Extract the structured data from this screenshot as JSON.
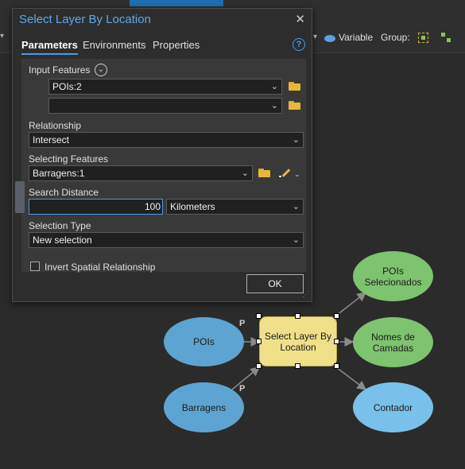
{
  "ribbon": {
    "variable_label": "Variable",
    "group_label": "Group:"
  },
  "dialog": {
    "title": "Select Layer By Location",
    "close_glyph": "✕",
    "tabs": [
      {
        "label": "Parameters",
        "active": true
      },
      {
        "label": "Environments",
        "active": false
      },
      {
        "label": "Properties",
        "active": false
      }
    ],
    "help_glyph": "?",
    "input_features_label": "Input Features",
    "input_features": [
      "POIs:2",
      ""
    ],
    "relationship_label": "Relationship",
    "relationship_value": "Intersect",
    "selecting_features_label": "Selecting Features",
    "selecting_features_value": "Barragens:1",
    "search_distance_label": "Search Distance",
    "search_distance_value": "100",
    "search_distance_unit": "Kilometers",
    "selection_type_label": "Selection Type",
    "selection_type_value": "New selection",
    "invert_label": "Invert Spatial Relationship",
    "invert_checked": false,
    "ok_label": "OK"
  },
  "model": {
    "nodes": {
      "pois": "POIs",
      "barragens": "Barragens",
      "tool": "Select Layer By Location",
      "pois_selecionados": "POIs Selecionados",
      "nomes_camadas": "Nomes de Camadas",
      "contador": "Contador"
    },
    "precondition_label": "P"
  },
  "colors": {
    "accent": "#4a9be8",
    "input_oval": "#5ea4d2",
    "output_oval": "#7ec36f",
    "value_oval": "#79c1ea",
    "tool_fill": "#f0e08a",
    "folder": "#e8b73a"
  },
  "icons": [
    "chevron-down-icon",
    "folder-icon",
    "pencil-icon",
    "close-icon",
    "help-icon",
    "expand-icon",
    "variable-icon",
    "group-icon"
  ]
}
